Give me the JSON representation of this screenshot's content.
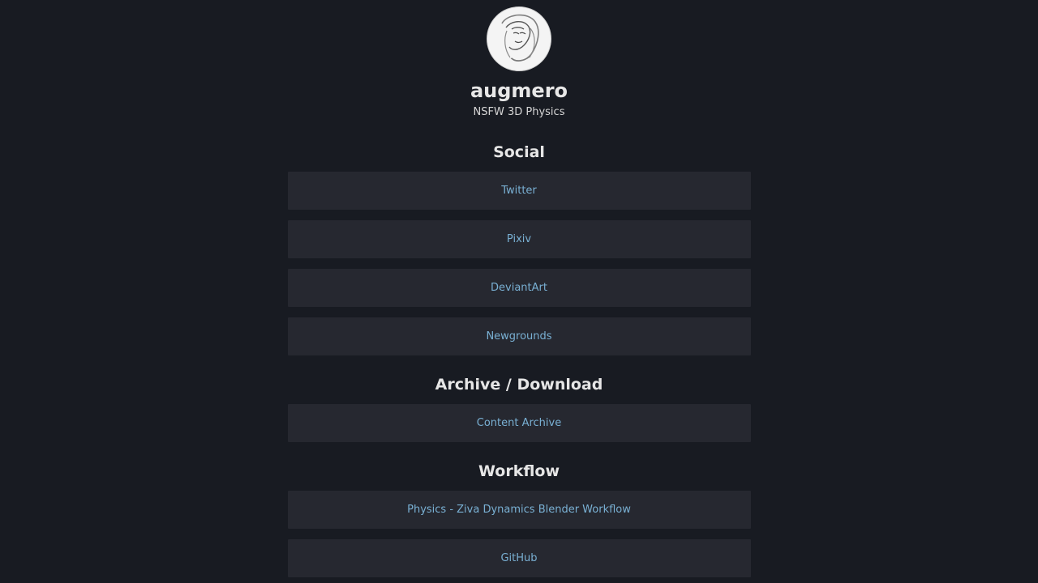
{
  "profile": {
    "name": "augmero",
    "tagline": "NSFW 3D Physics",
    "avatar_icon": "sketch-portrait-avatar"
  },
  "sections": [
    {
      "title": "Social",
      "links": [
        "Twitter",
        "Pixiv",
        "DeviantArt",
        "Newgrounds"
      ]
    },
    {
      "title": "Archive / Download",
      "links": [
        "Content Archive"
      ]
    },
    {
      "title": "Workflow",
      "links": [
        "Physics - Ziva Dynamics Blender Workflow",
        "GitHub"
      ]
    }
  ],
  "colors": {
    "background": "#181b22",
    "card": "#262830",
    "link": "#79b0d3",
    "heading": "#e6e6e6"
  }
}
